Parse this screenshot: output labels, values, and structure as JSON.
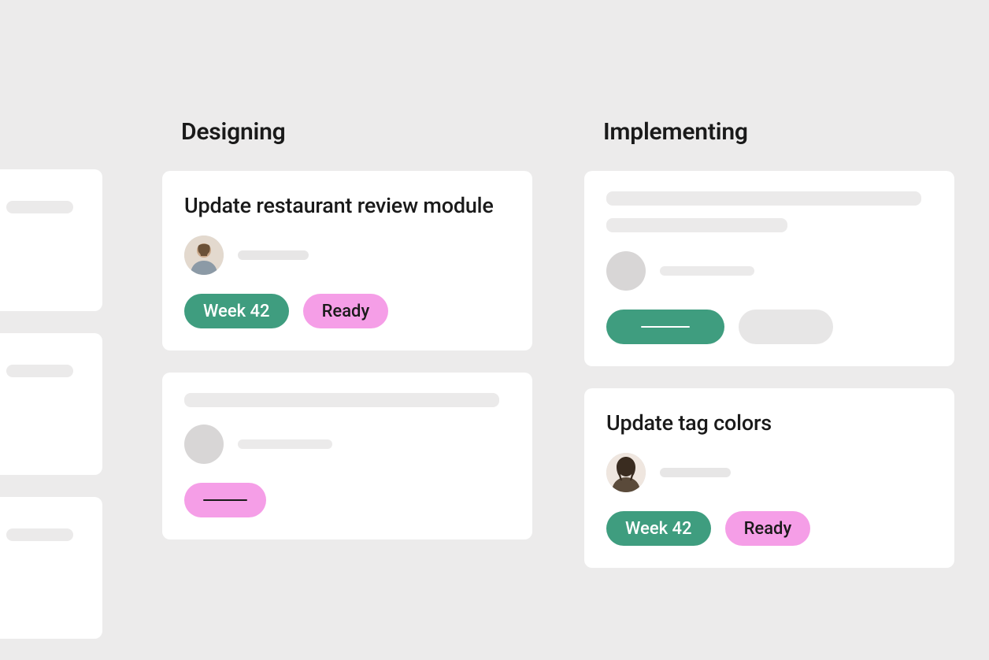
{
  "columns": [
    {
      "id": "designing",
      "title": "Designing",
      "cards": [
        {
          "id": "card1",
          "title": "Update restaurant review module",
          "tags": [
            {
              "label": "Week 42",
              "style": "green"
            },
            {
              "label": "Ready",
              "style": "pink"
            }
          ]
        }
      ]
    },
    {
      "id": "implementing",
      "title": "Implementing",
      "cards": [
        {
          "id": "card4",
          "title": "Update tag colors",
          "tags": [
            {
              "label": "Week 42",
              "style": "green"
            },
            {
              "label": "Ready",
              "style": "pink"
            }
          ]
        }
      ]
    }
  ],
  "colors": {
    "green": "#3f9d7f",
    "pink": "#f59ee7",
    "bg": "#ecebeb"
  }
}
